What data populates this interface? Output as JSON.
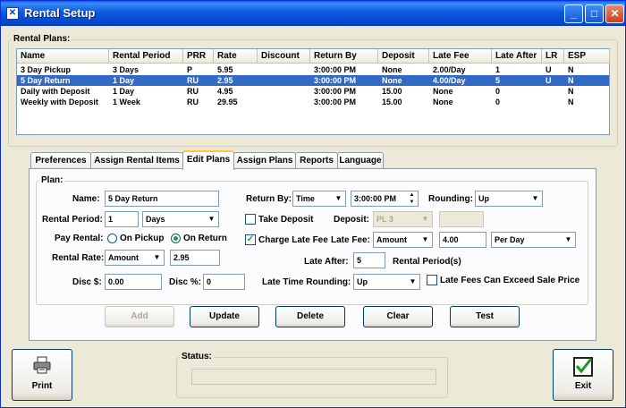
{
  "window": {
    "title": "Rental Setup",
    "min_label": "_",
    "max_label": "□",
    "close_label": "✕"
  },
  "rental_plans": {
    "label": "Rental Plans:",
    "columns": [
      "Name",
      "Rental Period",
      "PRR",
      "Rate",
      "Discount",
      "Return By",
      "Deposit",
      "Late Fee",
      "Late After",
      "LR",
      "ESP"
    ],
    "rows": [
      [
        "3 Day Pickup",
        "3 Days",
        "P",
        "5.95",
        "",
        "3:00:00 PM",
        "None",
        "2.00/Day",
        "1",
        "U",
        "N"
      ],
      [
        "5 Day Return",
        "1 Day",
        "RU",
        "2.95",
        "",
        "3:00:00 PM",
        "None",
        "4.00/Day",
        "5",
        "U",
        "N"
      ],
      [
        "Daily with Deposit",
        "1 Day",
        "RU",
        "4.95",
        "",
        "3:00:00 PM",
        "15.00",
        "None",
        "0",
        "",
        "N"
      ],
      [
        "Weekly with Deposit",
        "1 Week",
        "RU",
        "29.95",
        "",
        "3:00:00 PM",
        "15.00",
        "None",
        "0",
        "",
        "N"
      ]
    ],
    "selected_row": 1
  },
  "tabs": [
    {
      "label": "Preferences"
    },
    {
      "label": "Assign Rental Items"
    },
    {
      "label": "Edit Plans"
    },
    {
      "label": "Assign Plans"
    },
    {
      "label": "Reports"
    },
    {
      "label": "Language"
    }
  ],
  "active_tab": "Edit Plans",
  "plan": {
    "group_label": "Plan:",
    "name_label": "Name:",
    "name_value": "5 Day Return",
    "rental_period_label": "Rental Period:",
    "rental_period_value": "1",
    "rental_period_unit": "Days",
    "pay_rental_label": "Pay Rental:",
    "on_pickup_label": "On Pickup",
    "on_return_label": "On Return",
    "pay_rental_selected": "On Return",
    "rental_rate_label": "Rental Rate:",
    "rental_rate_type": "Amount",
    "rental_rate_value": "2.95",
    "disc_amount_label": "Disc $:",
    "disc_amount_value": "0.00",
    "disc_pct_label": "Disc %:",
    "disc_pct_value": "0",
    "return_by_label": "Return By:",
    "return_by_type": "Time",
    "return_by_time": "3:00:00 PM",
    "rounding_label": "Rounding:",
    "rounding_value": "Up",
    "take_deposit_label": "Take Deposit",
    "take_deposit_checked": false,
    "deposit_label": "Deposit:",
    "deposit_value": "PL 3",
    "deposit_amount": "",
    "charge_late_fee_label": "Charge Late Fee",
    "charge_late_fee_checked": true,
    "late_fee_label": "Late Fee:",
    "late_fee_type": "Amount",
    "late_fee_value": "4.00",
    "late_fee_period": "Per Day",
    "late_after_label": "Late After:",
    "late_after_value": "5",
    "late_after_unit": "Rental Period(s)",
    "late_time_rounding_label": "Late Time Rounding:",
    "late_time_rounding_value": "Up",
    "late_fees_exceed_label": "Late Fees Can Exceed Sale Price",
    "late_fees_exceed_checked": false
  },
  "actions": {
    "add": "Add",
    "update": "Update",
    "delete": "Delete",
    "clear": "Clear",
    "test": "Test"
  },
  "footer": {
    "print_label": "Print",
    "status_label": "Status:",
    "status_value": "",
    "exit_label": "Exit"
  },
  "colors": {
    "title_bar": "#0a5ae0",
    "selection": "#316ac5",
    "check_mark": "#21a121",
    "tab_highlight": "#ffc83c"
  }
}
